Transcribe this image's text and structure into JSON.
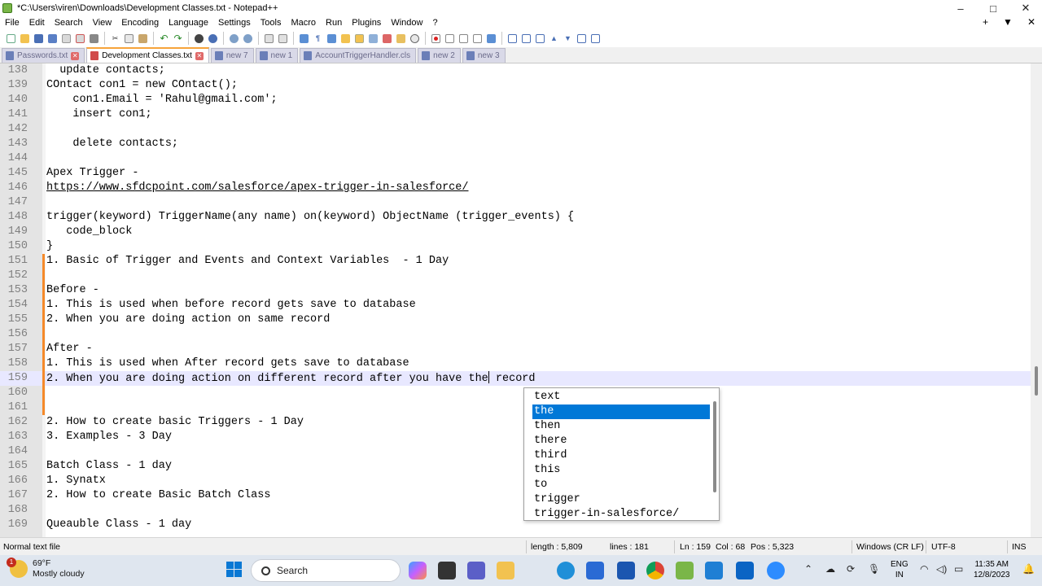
{
  "window": {
    "title": "*C:\\Users\\viren\\Downloads\\Development  Classes.txt - Notepad++",
    "controls": [
      "–",
      "□",
      "✕"
    ]
  },
  "menu": {
    "items": [
      "File",
      "Edit",
      "Search",
      "View",
      "Encoding",
      "Language",
      "Settings",
      "Tools",
      "Macro",
      "Run",
      "Plugins",
      "Window",
      "?"
    ],
    "right": [
      "+",
      "▼",
      "✕"
    ]
  },
  "tabs": [
    {
      "label": "Passwords.txt",
      "active": false
    },
    {
      "label": "Development  Classes.txt",
      "active": true
    },
    {
      "label": "new 7",
      "active": false
    },
    {
      "label": "new 1",
      "active": false
    },
    {
      "label": "AccountTriggerHandler.cls",
      "active": false
    },
    {
      "label": "new 2",
      "active": false
    },
    {
      "label": "new 3",
      "active": false
    }
  ],
  "editor": {
    "lines": [
      {
        "n": "138",
        "t": "  update contacts;"
      },
      {
        "n": "139",
        "t": "COntact con1 = new COntact();"
      },
      {
        "n": "140",
        "t": "    con1.Email = 'Rahul@gmail.com';"
      },
      {
        "n": "141",
        "t": "    insert con1;"
      },
      {
        "n": "142",
        "t": ""
      },
      {
        "n": "143",
        "t": "    delete contacts;"
      },
      {
        "n": "144",
        "t": ""
      },
      {
        "n": "145",
        "t": "Apex Trigger -"
      },
      {
        "n": "146",
        "t": "https://www.sfdcpoint.com/salesforce/apex-trigger-in-salesforce/"
      },
      {
        "n": "147",
        "t": ""
      },
      {
        "n": "148",
        "t": "trigger(keyword) TriggerName(any name) on(keyword) ObjectName (trigger_events) {"
      },
      {
        "n": "149",
        "t": "   code_block"
      },
      {
        "n": "150",
        "t": "}"
      },
      {
        "n": "151",
        "t": "1. Basic of Trigger and Events and Context Variables  - 1 Day"
      },
      {
        "n": "152",
        "t": ""
      },
      {
        "n": "153",
        "t": "Before -"
      },
      {
        "n": "154",
        "t": "1. This is used when before record gets save to database"
      },
      {
        "n": "155",
        "t": "2. When you are doing action on same record"
      },
      {
        "n": "156",
        "t": ""
      },
      {
        "n": "157",
        "t": "After -"
      },
      {
        "n": "158",
        "t": "1. This is used when After record gets save to database"
      },
      {
        "n": "159",
        "t": "2. When you are doing action on different record after you have the"
      },
      {
        "n": "160",
        "t": ""
      },
      {
        "n": "161",
        "t": ""
      },
      {
        "n": "162",
        "t": "2. How to create basic Triggers - 1 Day"
      },
      {
        "n": "163",
        "t": "3. Examples - 3 Day"
      },
      {
        "n": "164",
        "t": ""
      },
      {
        "n": "165",
        "t": "Batch Class - 1 day"
      },
      {
        "n": "166",
        "t": "1. Synatx"
      },
      {
        "n": "167",
        "t": "2. How to create Basic Batch Class"
      },
      {
        "n": "168",
        "t": ""
      },
      {
        "n": "169",
        "t": "Queauble Class - 1 day"
      }
    ],
    "current_line_after_caret": " record"
  },
  "autocomplete": {
    "items": [
      "text",
      "the",
      "then",
      "there",
      "third",
      "this",
      "to",
      "trigger",
      "trigger-in-salesforce/"
    ],
    "selected": 1
  },
  "status": {
    "filetype": "Normal text file",
    "length": "length : 5,809",
    "lines": "lines : 181",
    "ln": "Ln : 159",
    "col": "Col : 68",
    "pos": "Pos : 5,323",
    "eol": "Windows (CR LF)",
    "encoding": "UTF-8",
    "mode": "INS"
  },
  "taskbar": {
    "weather_badge": "1",
    "temp": "69°F",
    "weather": "Mostly cloudy",
    "search_placeholder": "Search",
    "lang1": "ENG",
    "lang2": "IN",
    "time": "11:35 AM",
    "date": "12/8/2023"
  }
}
